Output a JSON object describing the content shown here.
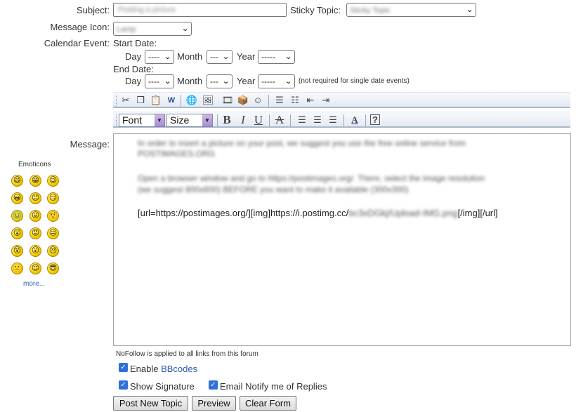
{
  "form": {
    "subject_label": "Subject:",
    "subject_value": "Posting a picture",
    "sticky_label": "Sticky Topic:",
    "sticky_value": "Sticky Topic",
    "icon_label": "Message Icon:",
    "icon_value": "Lamp",
    "calendar_label": "Calendar Event:",
    "start_date_label": "Start Date:",
    "end_date_label": "End Date:",
    "day_label": "Day",
    "month_label": "Month",
    "year_label": "Year",
    "day_value": "----",
    "month_value": "---",
    "year_value": "-----",
    "date_note": "(not required for single date events)",
    "message_label": "Message:"
  },
  "toolbar": {
    "row1_icons": [
      "cut-icon",
      "copy-icon",
      "paste-icon",
      "word-paste-icon",
      "link-icon",
      "image-icon",
      "video-icon",
      "flash-icon",
      "emoticon-icon",
      "ordered-list-icon",
      "unordered-list-icon",
      "outdent-icon",
      "indent-icon"
    ],
    "font_value": "Font",
    "size_value": "Size",
    "row2_icons": [
      "bold-icon",
      "italic-icon",
      "underline-icon",
      "strikethrough-icon",
      "align-left-icon",
      "align-center-icon",
      "align-right-icon",
      "font-color-icon",
      "help-icon"
    ]
  },
  "emoticons": {
    "title": "Emoticons",
    "faces": [
      "😄",
      "😁",
      "😉",
      "😀",
      "😊",
      "😏",
      "🤢",
      "😛",
      "🤨",
      "😲",
      "😡",
      "😐",
      "😵",
      "😮",
      "😒",
      "🙁",
      "😌",
      "😎"
    ],
    "more_label": "more..."
  },
  "message": {
    "line1": "In order to insert a picture on your post, we suggest you use the free online service from",
    "line1b": "POSTIMAGES.ORG",
    "line2": "Open a browser window and go to https://postimages.org/. There, select the image resolution",
    "line2b": "(we suggest 800x600) BEFORE you want to make it available (300x300)",
    "code_prefix": "[url=https://postimages.org/][img]https://i.postimg.cc/",
    "code_blurred": "bc3xDGkj/Upload-IMG.png",
    "code_suffix": "[/img][/url]"
  },
  "options": {
    "nofollow_note": "NoFollow is applied to all links from this forum",
    "enable_label": "Enable ",
    "bbcodes_link": "BBcodes",
    "show_signature": "Show Signature",
    "email_notify": "Email Notify me of Replies"
  },
  "buttons": {
    "post": "Post New Topic",
    "preview": "Preview",
    "clear": "Clear Form"
  }
}
